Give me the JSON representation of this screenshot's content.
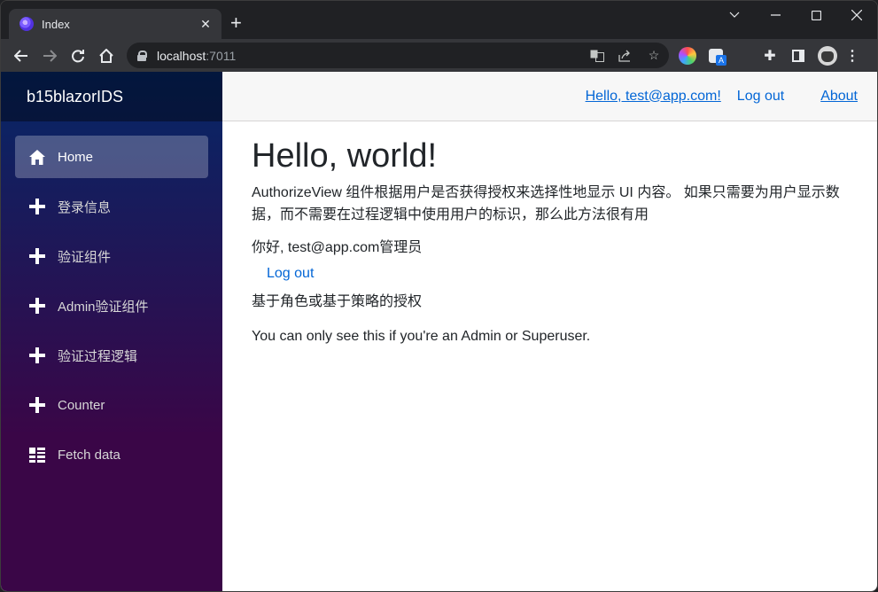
{
  "browser": {
    "tab_title": "Index",
    "url_host": "localhost",
    "url_port": ":7011"
  },
  "app": {
    "brand": "b15blazorIDS",
    "nav_items": [
      {
        "label": "Home",
        "icon": "home-icon",
        "active": true
      },
      {
        "label": "登录信息",
        "icon": "plus-icon",
        "active": false
      },
      {
        "label": "验证组件",
        "icon": "plus-icon",
        "active": false
      },
      {
        "label": "Admin验证组件",
        "icon": "plus-icon",
        "active": false
      },
      {
        "label": "验证过程逻辑",
        "icon": "plus-icon",
        "active": false
      },
      {
        "label": "Counter",
        "icon": "plus-icon",
        "active": false
      },
      {
        "label": "Fetch data",
        "icon": "list-icon",
        "active": false
      }
    ],
    "top_row": {
      "user_link": "Hello, test@app.com!",
      "logout": "Log out",
      "about": "About"
    },
    "content": {
      "heading": "Hello, world!",
      "intro": "AuthorizeView 组件根据用户是否获得授权来选择性地显示 UI 内容。 如果只需要为用户显示数据，而不需要在过程逻辑中使用用户的标识，那么此方法很有用",
      "greeting": "你好, test@app.com管理员",
      "logout_link": "Log out",
      "policy_text": "基于角色或基于策略的授权",
      "admin_text": "You can only see this if you're an Admin or Superuser."
    },
    "colors": {
      "link": "#0366d6",
      "sidebar_top": "#052767",
      "sidebar_bottom": "#3a0647"
    }
  }
}
